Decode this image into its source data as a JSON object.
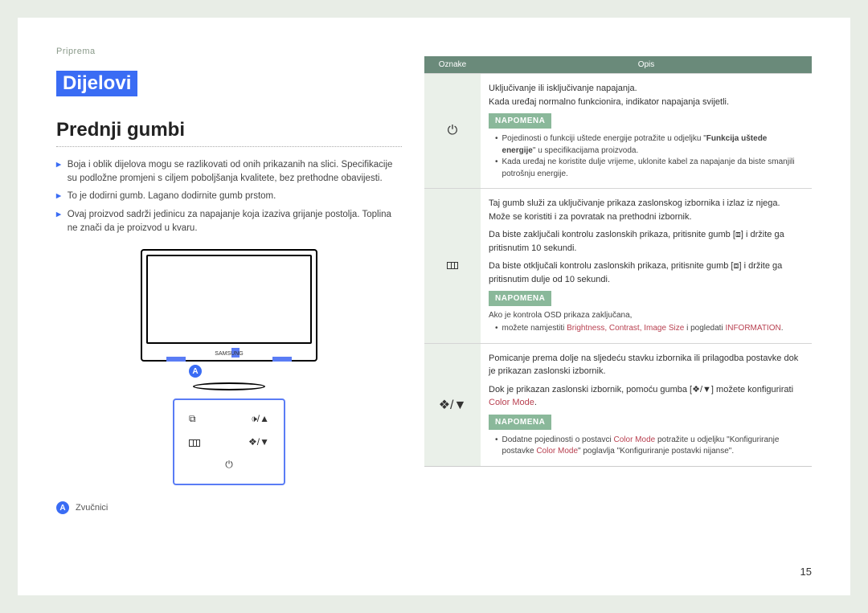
{
  "breadcrumb": "Priprema",
  "section_title": "Dijelovi",
  "subtitle": "Prednji gumbi",
  "left_bullets": [
    "Boja i oblik dijelova mogu se razlikovati od onih prikazanih na slici. Specifikacije su podložne promjeni s ciljem poboljšanja kvalitete, bez prethodne obavijesti.",
    "To je dodirni gumb. Lagano dodirnite gumb prstom.",
    "Ovaj proizvod sadrži jedinicu za napajanje koja izaziva grijanje postolja. Toplina ne znači da je proizvod u kvaru."
  ],
  "brand": "SAMSUNG",
  "callout_letter": "A",
  "legend_label": "Zvučnici",
  "table": {
    "head": {
      "col1": "Oznake",
      "col2": "Opis"
    },
    "rows": [
      {
        "icon": "power",
        "lines": [
          "Uključivanje ili isključivanje napajanja.",
          "Kada uređaj normalno funkcionira, indikator napajanja svijetli."
        ],
        "note_tag": "NAPOMENA",
        "note_items": [
          {
            "pre": "Pojedinosti o funkciji uštede energije potražite u odjeljku \"",
            "bold": "Funkcija uštede energije",
            "post": "\" u specifikacijama proizvoda."
          },
          {
            "pre": "Kada uređaj ne koristite dulje vrijeme, uklonite kabel za napajanje da biste smanjili potrošnju energije.",
            "bold": "",
            "post": ""
          }
        ]
      },
      {
        "icon": "menu",
        "lines": [
          "Taj gumb služi za uključivanje prikaza zaslonskog izbornika i izlaz iz njega. Može se koristiti i za povratak na prethodni izbornik.",
          "Da biste zaključali kontrolu zaslonskih prikaza, pritisnite gumb [⧈] i držite ga pritisnutim 10 sekundi.",
          "Da biste otključali kontrolu zaslonskih prikaza, pritisnite gumb [⧈] i držite ga pritisnutim dulje od 10 sekundi."
        ],
        "note_tag": "NAPOMENA",
        "note_plain": "Ako je kontrola OSD prikaza zaključana,",
        "note_items_red": {
          "pre": "možete namjestiti ",
          "red1": "Brightness, Contrast, Image Size",
          "mid": " i pogledati ",
          "red2": "INFORMATION",
          "post": "."
        }
      },
      {
        "icon": "updown",
        "lines_compound": {
          "l1": "Pomicanje prema dolje na sljedeću stavku izbornika ili prilagodba postavke dok je prikazan zaslonski izbornik.",
          "l2_pre": "Dok je prikazan zaslonski izbornik, pomoću gumba [❖/▼] možete konfigurirati ",
          "l2_red": "Color Mode",
          "l2_post": "."
        },
        "note_tag": "NAPOMENA",
        "note_items_compound": {
          "pre": "Dodatne pojedinosti o postavci ",
          "red1": "Color Mode",
          "mid1": " potražite u odjeljku \"Konfiguriranje postavke ",
          "red2": "Color Mode",
          "mid2": "\" poglavlja \"Konfiguriranje postavki nijanse\"."
        }
      }
    ]
  },
  "page_number": "15"
}
